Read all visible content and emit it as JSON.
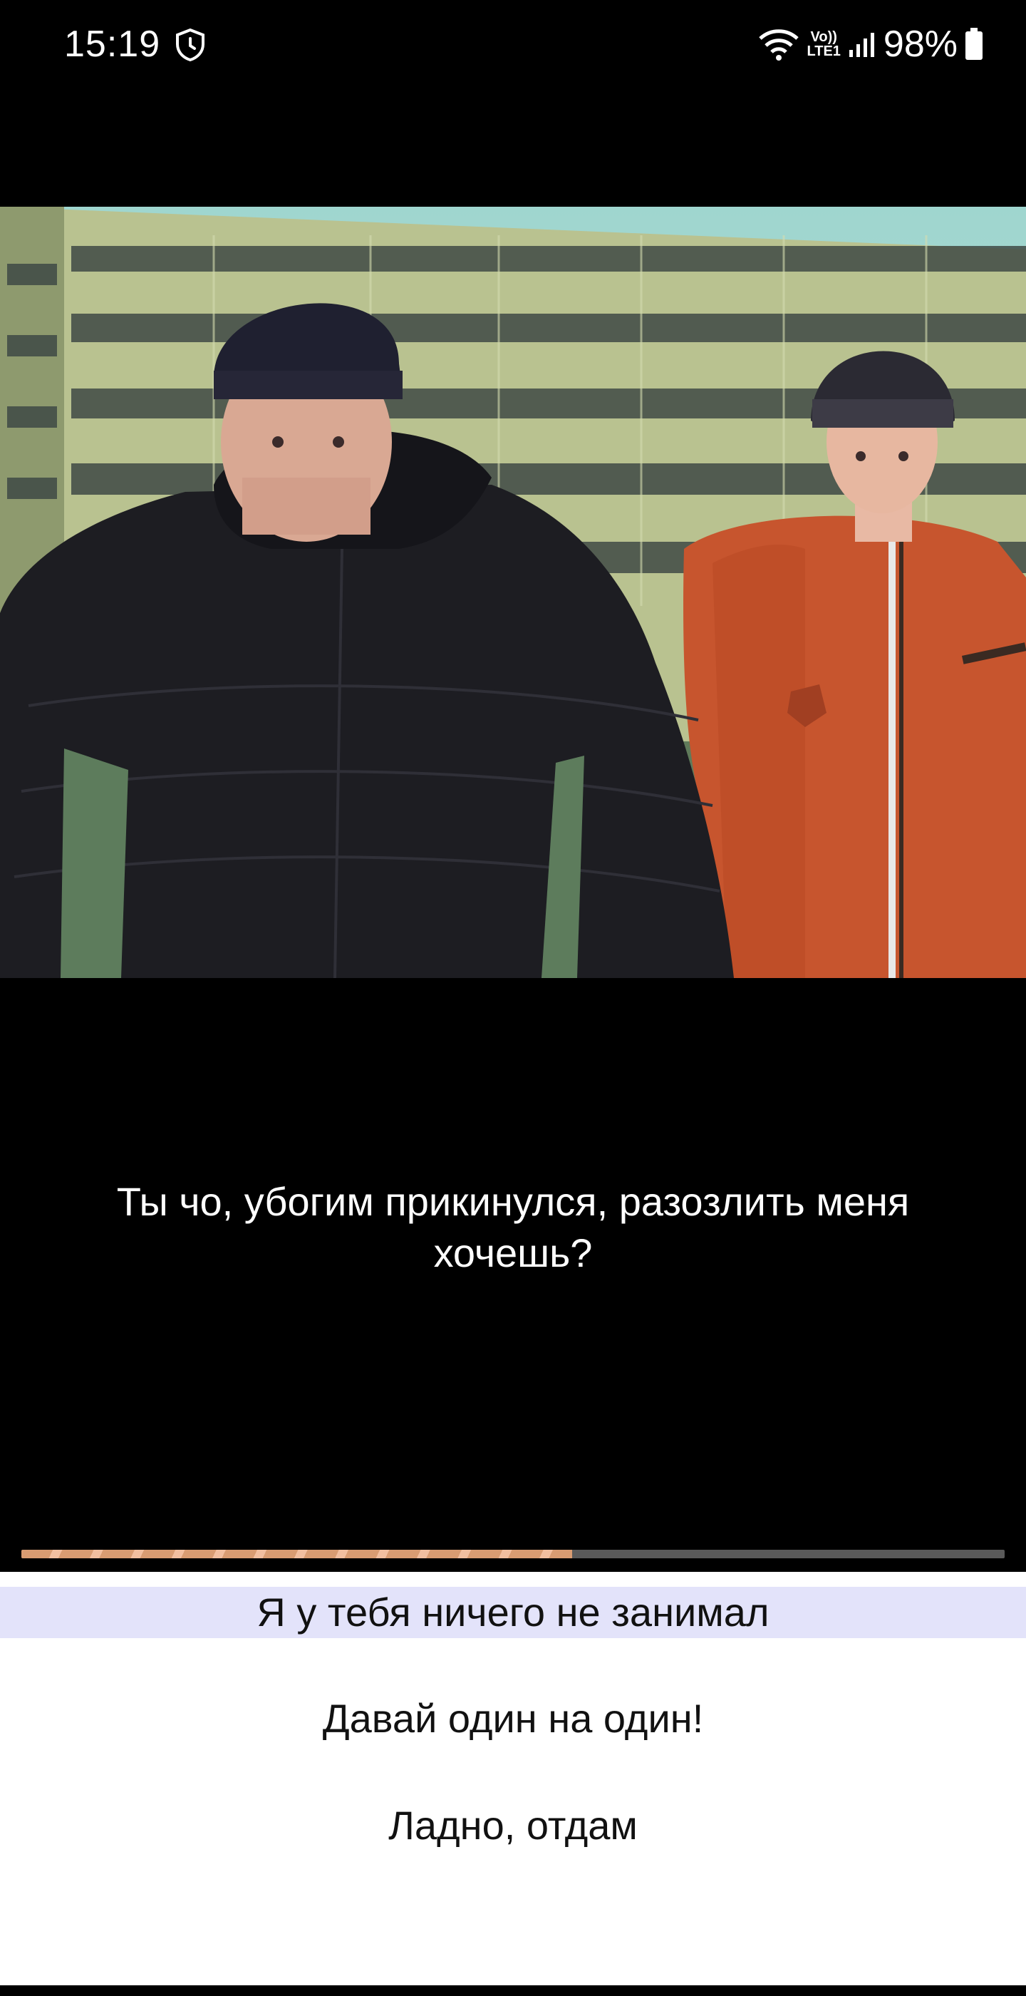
{
  "status_bar": {
    "time": "15:19",
    "icons": [
      "shield-clock-icon",
      "wifi-icon",
      "volte-lte-icon",
      "signal-icon",
      "battery-icon"
    ],
    "volte_label": "Vo))",
    "lte_label": "LTE1",
    "battery_percent": "98%"
  },
  "scene": {
    "description_icon": "scene-image",
    "characters": [
      "man-black-jacket",
      "man-orange-jacket"
    ]
  },
  "dialogue": {
    "text": "Ты чо, убогим прикинулся, разозлить меня хочешь?"
  },
  "progress": {
    "fraction": 0.56,
    "fill_color": "#d99c72",
    "track_color": "#5a5a5a"
  },
  "choices": [
    {
      "label": "Я у тебя ничего не занимал",
      "selected": true
    },
    {
      "label": "Давай один на один!",
      "selected": false
    },
    {
      "label": "Ладно, отдам",
      "selected": false
    }
  ],
  "colors": {
    "background": "#000000",
    "choice_highlight": "#e3e3fa",
    "choices_background": "#ffffff"
  }
}
